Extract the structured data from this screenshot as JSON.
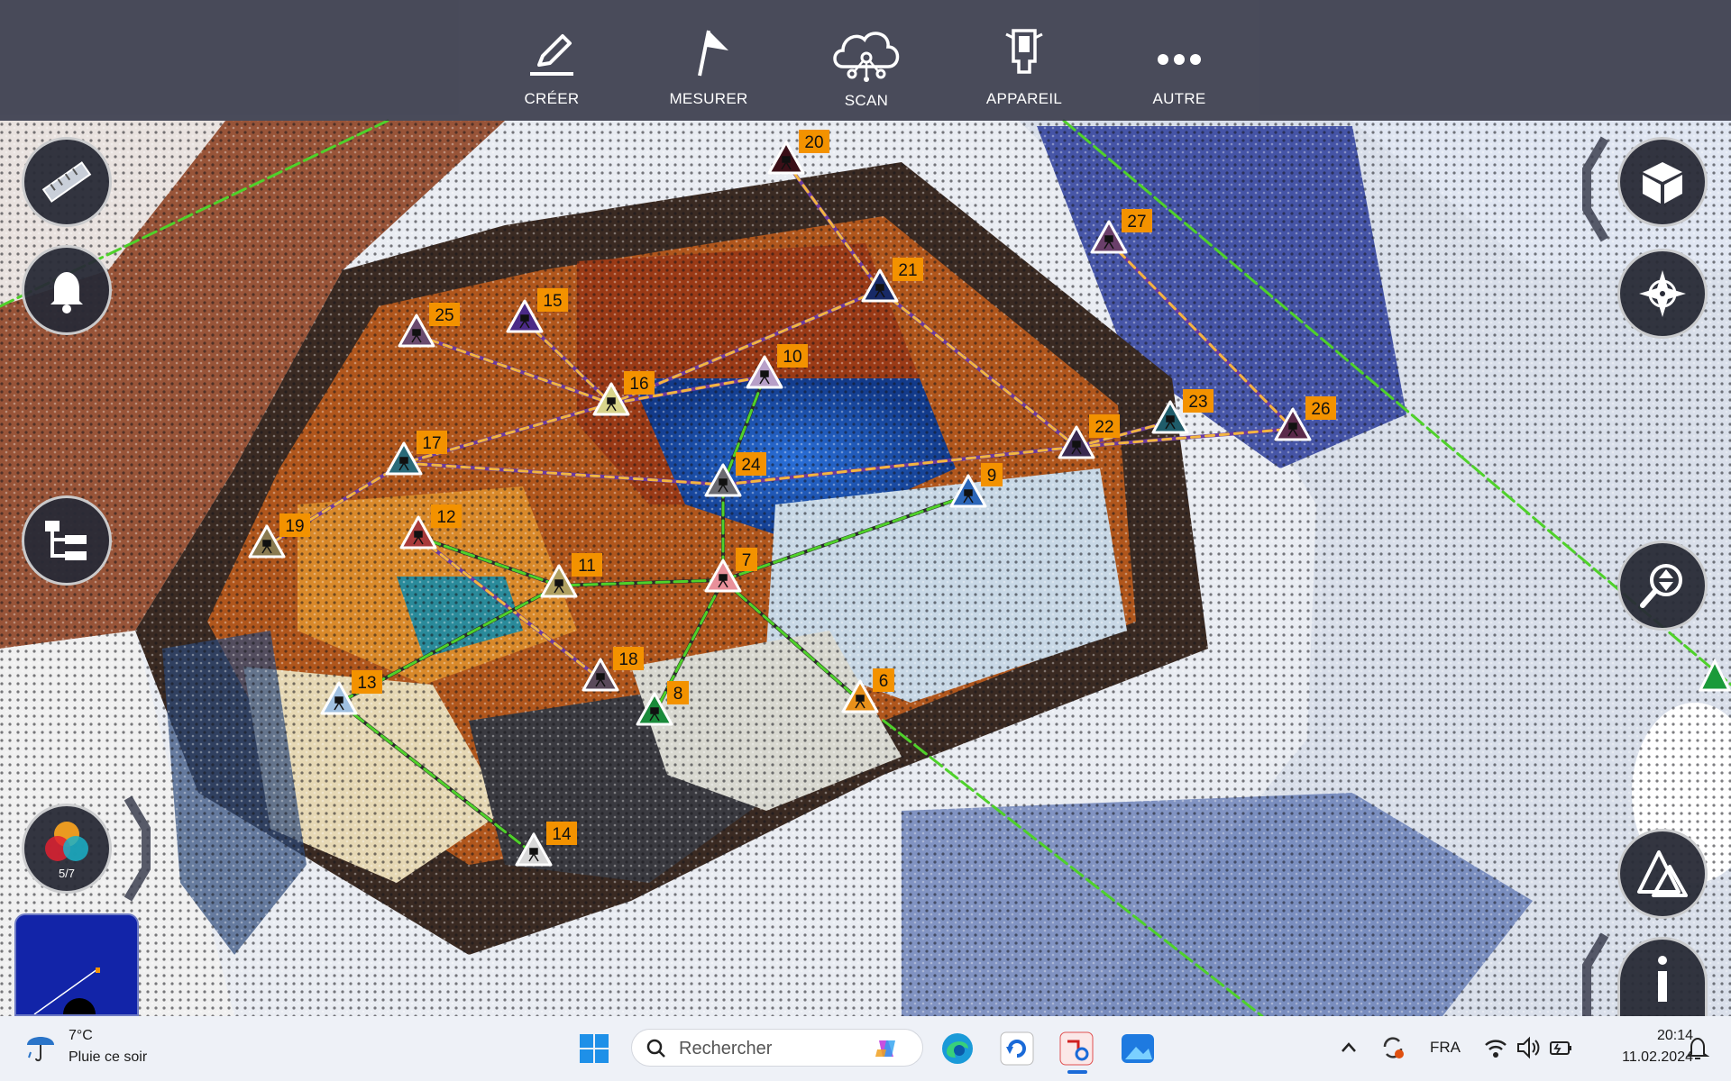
{
  "toolbar": {
    "items": [
      {
        "label": "CRÉER",
        "icon": "pencil-icon"
      },
      {
        "label": "MESURER",
        "icon": "flag-icon"
      },
      {
        "label": "SCAN",
        "icon": "cloud-network-icon"
      },
      {
        "label": "APPAREIL",
        "icon": "scanner-device-icon"
      },
      {
        "label": "AUTRE",
        "icon": "more-dots-icon"
      }
    ]
  },
  "left_panel": {
    "color_filter_count": "5/7"
  },
  "markers": [
    {
      "id": "20",
      "color": "#3b1018"
    },
    {
      "id": "21",
      "color": "#182a66"
    },
    {
      "id": "27",
      "color": "#6a3f6a"
    },
    {
      "id": "15",
      "color": "#4b2a86"
    },
    {
      "id": "25",
      "color": "#6a4a6e"
    },
    {
      "id": "16",
      "color": "#d8d48a"
    },
    {
      "id": "10",
      "color": "#b8a0c8"
    },
    {
      "id": "23",
      "color": "#1f5c6a"
    },
    {
      "id": "26",
      "color": "#5a2a4a"
    },
    {
      "id": "22",
      "color": "#3a2a50"
    },
    {
      "id": "17",
      "color": "#2a6a78"
    },
    {
      "id": "24",
      "color": "#6a6a70"
    },
    {
      "id": "9",
      "color": "#2c66b8"
    },
    {
      "id": "19",
      "color": "#8a7a50"
    },
    {
      "id": "12",
      "color": "#a83a3a"
    },
    {
      "id": "11",
      "color": "#b0a060"
    },
    {
      "id": "7",
      "color": "#e8909a"
    },
    {
      "id": "18",
      "color": "#5a4a5a"
    },
    {
      "id": "13",
      "color": "#a0c0e0"
    },
    {
      "id": "8",
      "color": "#1a8a3a"
    },
    {
      "id": "6",
      "color": "#e8901a"
    },
    {
      "id": "14",
      "color": "#d8d8d8"
    }
  ],
  "taskbar": {
    "weather_temp": "7°C",
    "weather_desc": "Pluie ce soir",
    "search_placeholder": "Rechercher",
    "language": "FRA",
    "time": "20:14",
    "date": "11.02.2024"
  },
  "colors": {
    "marker_label_bg": "#f39200",
    "link_dashed": "#f2b640",
    "link_green": "#4fd12a"
  }
}
